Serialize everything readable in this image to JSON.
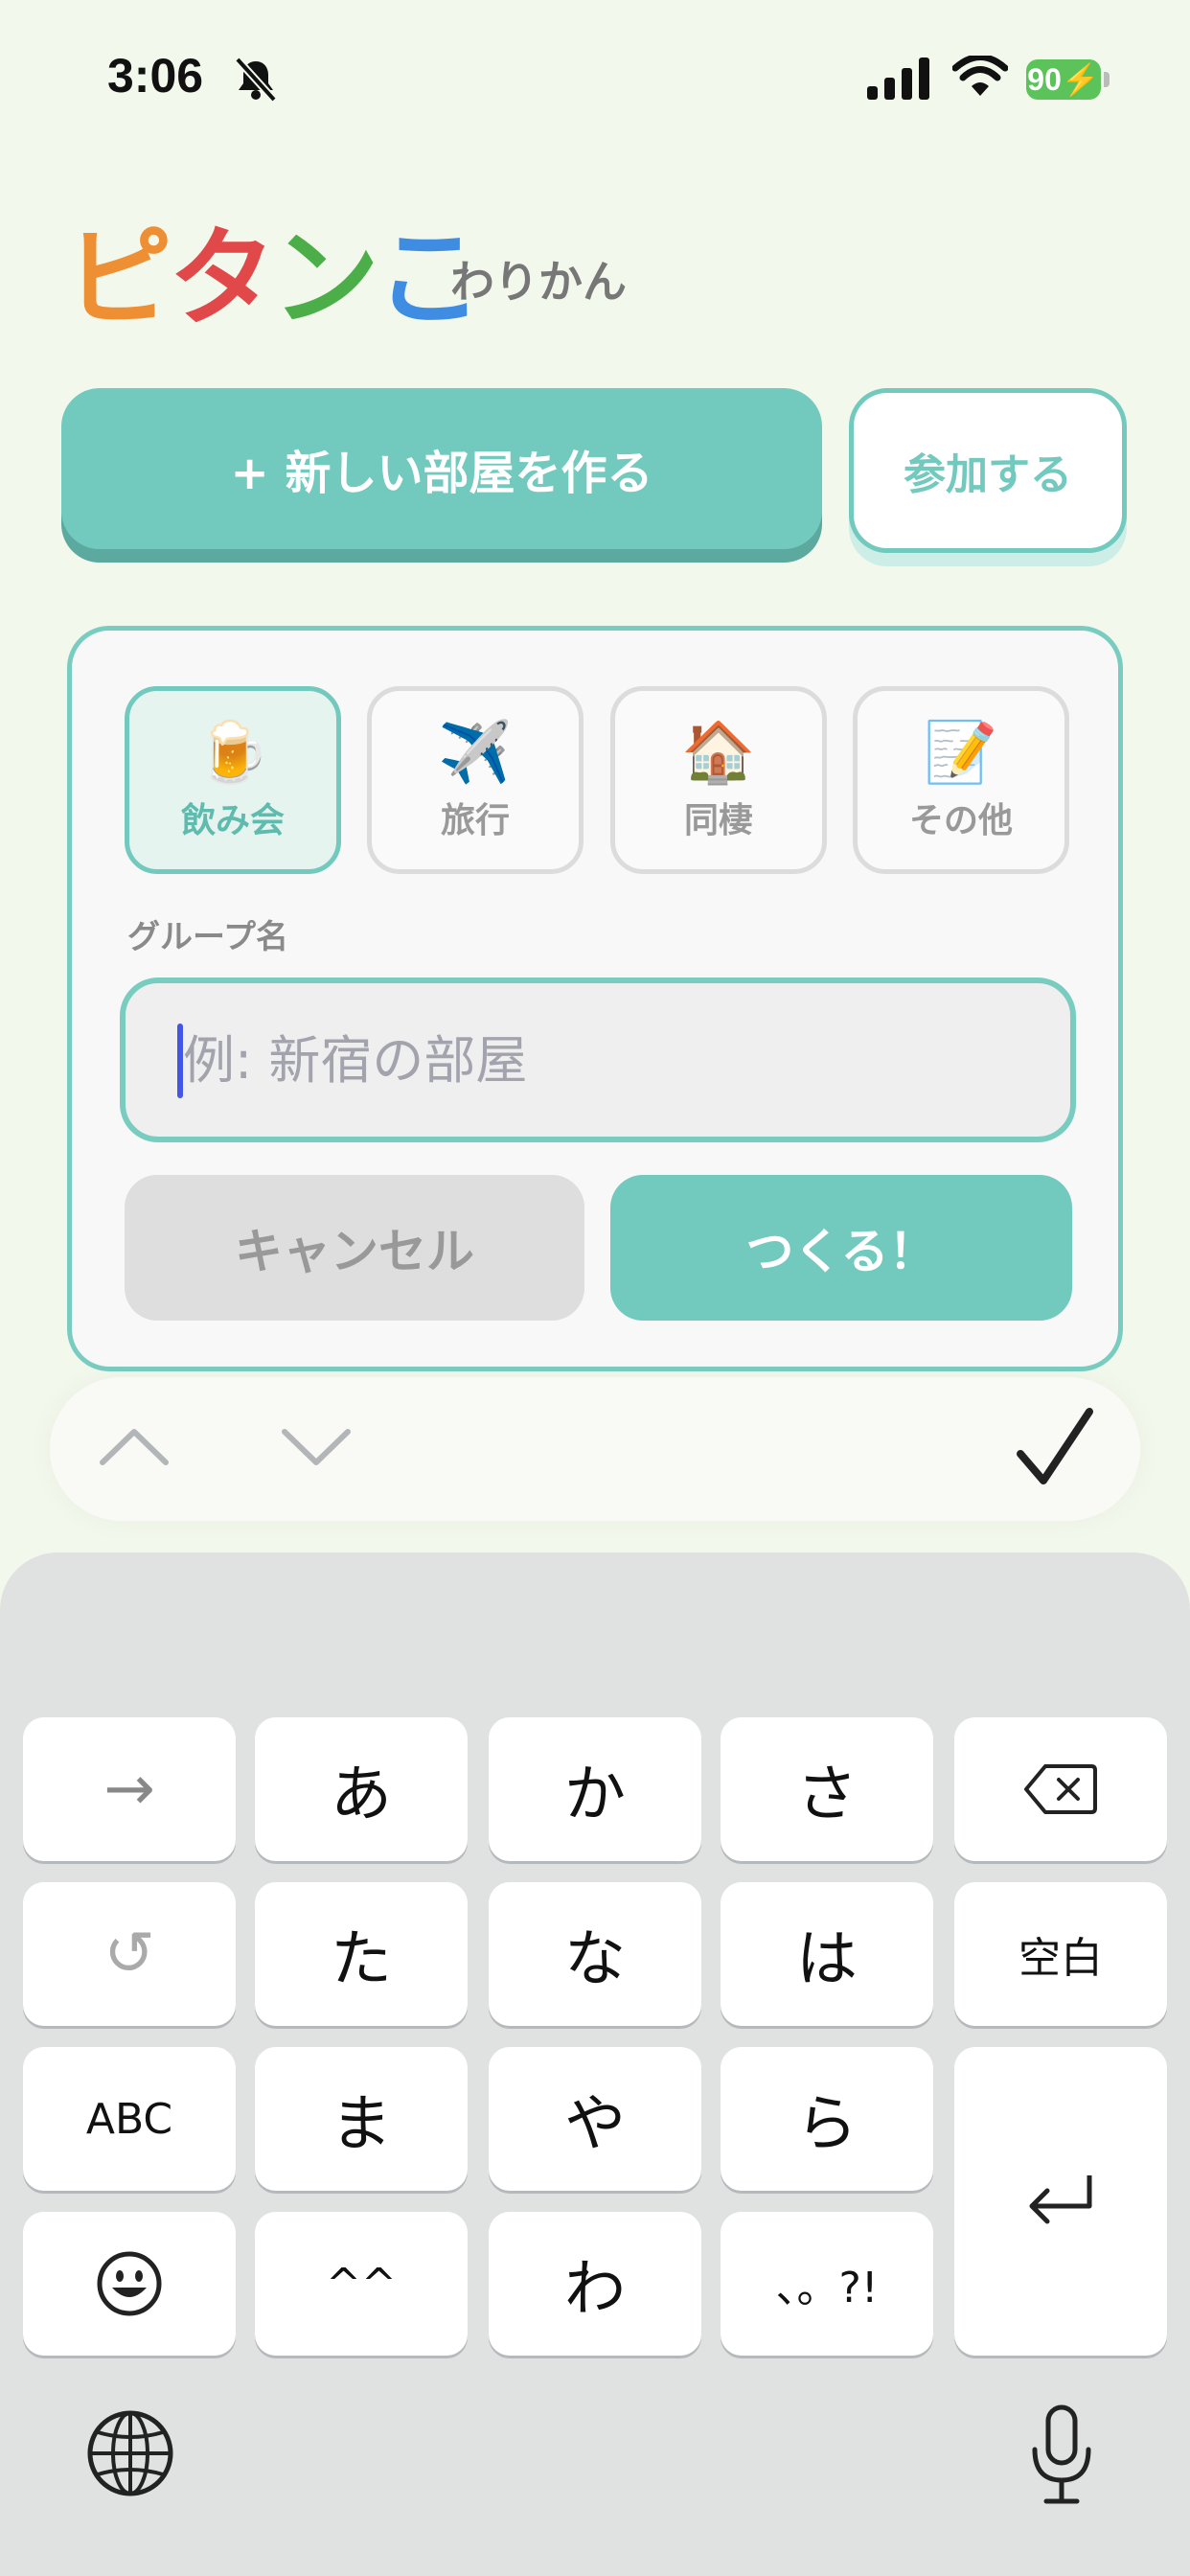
{
  "status_bar": {
    "time": "3:06",
    "battery": "90"
  },
  "app": {
    "logo": [
      "ピ",
      "タ",
      "ン",
      "こ"
    ],
    "logo_sub": "わりかん"
  },
  "actions": {
    "new_room": "+ 新しい部屋を作る",
    "join": "参加する"
  },
  "form": {
    "categories": [
      {
        "emoji": "🍺",
        "label": "飲み会",
        "selected": true
      },
      {
        "emoji": "✈️",
        "label": "旅行",
        "selected": false
      },
      {
        "emoji": "🏠",
        "label": "同棲",
        "selected": false
      },
      {
        "emoji": "📝",
        "label": "その他",
        "selected": false
      }
    ],
    "group_name_label": "グループ名",
    "group_name_placeholder": "例: 新宿の部屋",
    "group_name_value": "",
    "cancel": "キャンセル",
    "create": "つくる！"
  },
  "keyboard": {
    "row1": [
      "→",
      "あ",
      "か",
      "さ",
      "⌫"
    ],
    "row2": [
      "↺",
      "た",
      "な",
      "は",
      "空白"
    ],
    "row3": [
      "ABC",
      "ま",
      "や",
      "ら"
    ],
    "row4": [
      "😀",
      "^^",
      "わ",
      "、。?!"
    ],
    "return": "⏎"
  },
  "icons": {
    "status": [
      "bell-slash-icon",
      "signal-icon",
      "wifi-icon"
    ],
    "accessory": [
      "chevron-up-icon",
      "chevron-down-icon",
      "checkmark-icon"
    ],
    "keyboard": [
      "globe-icon",
      "microphone-icon"
    ]
  },
  "colors": {
    "accent": "#72c9bd",
    "background": "#f3f8ec",
    "battery": "#5cc35a"
  }
}
